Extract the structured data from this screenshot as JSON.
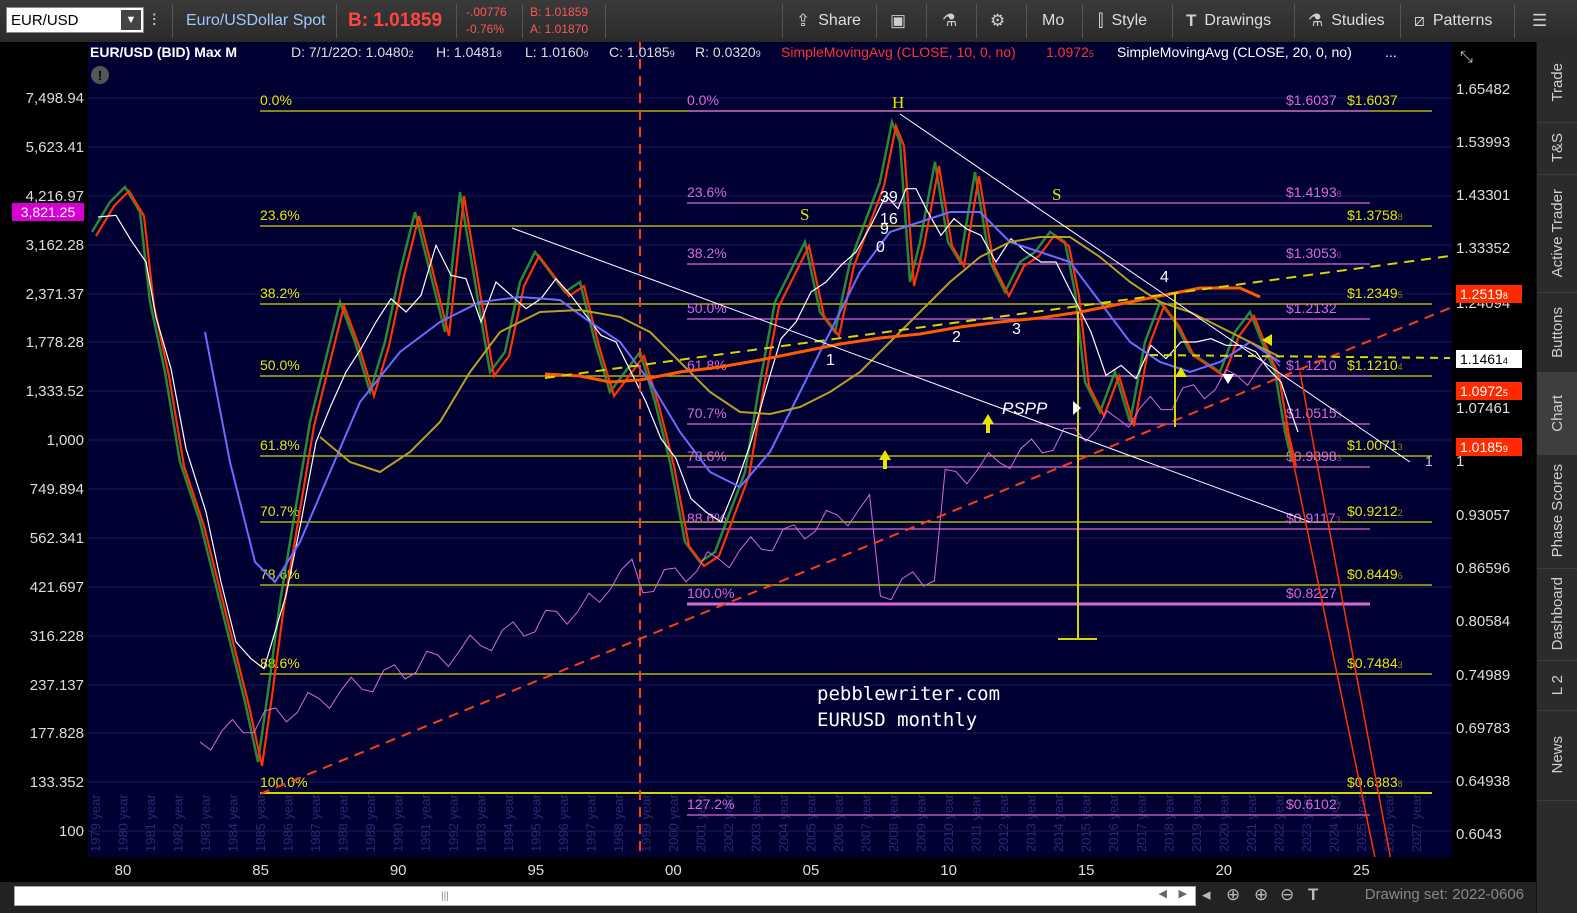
{
  "toolbar": {
    "symbol": "EUR/USD",
    "description": "Euro/USDollar Spot",
    "bid": "B: 1.01859",
    "change": "-.00776",
    "change_pct": "-0.76%",
    "bid_small": "B: 1.01859",
    "ask_small": "A: 1.01870",
    "share": "Share",
    "mo": "Mo",
    "style": "Style",
    "drawings": "Drawings",
    "studies": "Studies",
    "patterns": "Patterns"
  },
  "chart_header": {
    "title": "EUR/USD (BID) Max M",
    "date": "D: 7/1/22",
    "open": "O: 1.0480",
    "open_sub": "2",
    "high": "H: 1.0481",
    "high_sub": "8",
    "low": "L: 1.0160",
    "low_sub": "9",
    "close": "C: 1.0185",
    "close_sub": "9",
    "range": "R: 0.0320",
    "range_sub": "9",
    "sma10": "SimpleMovingAvg (CLOSE, 10, 0, no)",
    "sma10_val": "1.0972",
    "sma10_sub": "5",
    "sma20": "SimpleMovingAvg (CLOSE, 20, 0, no)",
    "more": "..."
  },
  "left_axis": [
    "7,498.94",
    "5,623.41",
    "4,216.97",
    "3,162.28",
    "2,371.37",
    "1,778.28",
    "1,333.52",
    "1,000",
    "749.894",
    "562.341",
    "421.697",
    "316.228",
    "237.137",
    "177.828",
    "133.352",
    "100"
  ],
  "left_marker": "3,821.25",
  "right_axis": [
    "1.65482",
    "1.53993",
    "1.43301",
    "1.33352",
    "1.24094",
    "1.07461",
    "1",
    "0.93057",
    "0.86596",
    "0.80584",
    "0.74989",
    "0.69783",
    "0.64938",
    "0.6043"
  ],
  "right_markers": {
    "sma_a": "1.2519",
    "sma_a_sub": "8",
    "level": "1.1461",
    "level_sub": "4",
    "sma10": "1.0972",
    "sma10_sub": "5",
    "price": "1.0185",
    "price_sub": "9"
  },
  "x_axis": [
    "80",
    "85",
    "90",
    "95",
    "00",
    "05",
    "10",
    "15",
    "20",
    "25"
  ],
  "year_labels": [
    "1979 year",
    "1980 year",
    "1981 year",
    "1982 year",
    "1983 year",
    "1984 year",
    "1985 year",
    "1986 year",
    "1987 year",
    "1988 year",
    "1989 year",
    "1990 year",
    "1991 year",
    "1992 year",
    "1993 year",
    "1994 year",
    "1995 year",
    "1996 year",
    "1997 year",
    "1998 year",
    "1999 year",
    "2000 year",
    "2001 year",
    "2002 year",
    "2003 year",
    "2004 year",
    "2005 year",
    "2006 year",
    "2007 year",
    "2008 year",
    "2009 year",
    "2010 year",
    "2011 year",
    "2012 year",
    "2013 year",
    "2014 year",
    "2015 year",
    "2016 year",
    "2017 year",
    "2018 year",
    "2019 year",
    "2020 year",
    "2021 year",
    "2022 year",
    "2023 year",
    "2024 year",
    "2025 year",
    "2026 year",
    "2027 year"
  ],
  "fib_left": {
    "levels": [
      "0.0%",
      "23.6%",
      "38.2%",
      "50.0%",
      "61.8%",
      "70.7%",
      "78.6%",
      "88.6%",
      "100.0%"
    ],
    "prices": [
      "$1.6037",
      "$1.3758",
      "$1.2349",
      "$1.1210",
      "$1.0071",
      "$0.9212",
      "$0.8449",
      "$0.7484",
      "$0.6383"
    ],
    "price_subs": [
      "",
      "8",
      "5",
      "4",
      "3",
      "2",
      "6",
      "3",
      "8"
    ]
  },
  "fib_right": {
    "levels": [
      "0.0%",
      "23.6%",
      "38.2%",
      "50.0%",
      "61.8%",
      "70.7%",
      "78.6%",
      "88.6%",
      "100.0%",
      "127.2%"
    ],
    "prices": [
      "$1.6037",
      "$1.4193",
      "$1.3053",
      "$1.2132",
      "$1.1210",
      "$1.0515",
      "$0.9898",
      "$0.9117",
      "$0.8227",
      "$0.6102"
    ],
    "price_subs": [
      "",
      "8",
      "6",
      "",
      "",
      "3",
      "3",
      "3",
      "",
      "7"
    ]
  },
  "annotations": {
    "H": "H",
    "S1": "S",
    "S2": "S",
    "n1": "1",
    "n2": "2",
    "n3": "3",
    "n4": "4",
    "pspp": "PSPP",
    "numbers_a": "39",
    "numbers_b": "16",
    "numbers_c": "9",
    "numbers_d": "0",
    "watermark1": "pebblewriter.com",
    "watermark2": "EURUSD monthly",
    "right_one": "1"
  },
  "right_tabs": [
    "Trade",
    "T&S",
    "Active Trader",
    "Buttons",
    "Chart",
    "Phase Scores",
    "Dashboard",
    "L 2",
    "News"
  ],
  "bottom": {
    "drawing_set": "Drawing set: 2022-0606"
  },
  "colors": {
    "plot_bg": "#000033",
    "fib_yellow": "#d6d600",
    "fib_magenta": "#d86ad8",
    "sma10": "#ff2a00",
    "sma20_white": "#ffffff",
    "sma_blue": "#6b6bff",
    "sma_gold": "#b9a020",
    "sma_long": "#ff5a00",
    "trend_red": "#ff3b1f"
  }
}
